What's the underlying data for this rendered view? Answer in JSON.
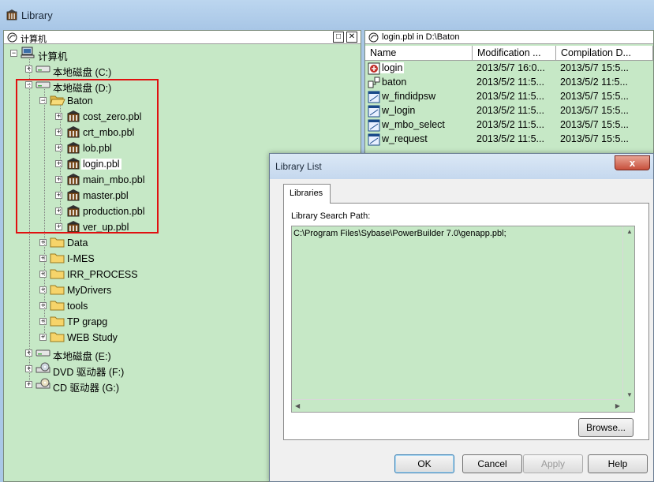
{
  "window": {
    "title": "Library"
  },
  "left_pane": {
    "header": "计算机",
    "buttons": {
      "restore": "□",
      "close": "✕"
    },
    "tree": [
      {
        "label": "计算机",
        "level": 0,
        "expander": "−",
        "icon": "computer-icon"
      },
      {
        "label": "本地磁盘 (C:)",
        "level": 1,
        "expander": "+",
        "icon": "drive-icon"
      },
      {
        "label": "本地磁盘 (D:)",
        "level": 1,
        "expander": "−",
        "icon": "drive-icon"
      },
      {
        "label": "Baton",
        "level": 2,
        "expander": "−",
        "icon": "folder-open-icon"
      },
      {
        "label": "cost_zero.pbl",
        "level": 3,
        "expander": "+",
        "icon": "library-icon"
      },
      {
        "label": "crt_mbo.pbl",
        "level": 3,
        "expander": "+",
        "icon": "library-icon"
      },
      {
        "label": "lob.pbl",
        "level": 3,
        "expander": "+",
        "icon": "library-icon"
      },
      {
        "label": "login.pbl",
        "level": 3,
        "expander": "+",
        "icon": "library-icon",
        "selected": true
      },
      {
        "label": "main_mbo.pbl",
        "level": 3,
        "expander": "+",
        "icon": "library-icon"
      },
      {
        "label": "master.pbl",
        "level": 3,
        "expander": "+",
        "icon": "library-icon"
      },
      {
        "label": "production.pbl",
        "level": 3,
        "expander": "+",
        "icon": "library-icon"
      },
      {
        "label": "ver_up.pbl",
        "level": 3,
        "expander": "+",
        "icon": "library-icon"
      },
      {
        "label": "Data",
        "level": 2,
        "expander": "+",
        "icon": "folder-icon"
      },
      {
        "label": "I-MES",
        "level": 2,
        "expander": "+",
        "icon": "folder-icon"
      },
      {
        "label": "IRR_PROCESS",
        "level": 2,
        "expander": "+",
        "icon": "folder-icon"
      },
      {
        "label": "MyDrivers",
        "level": 2,
        "expander": "+",
        "icon": "folder-icon"
      },
      {
        "label": "tools",
        "level": 2,
        "expander": "+",
        "icon": "folder-icon"
      },
      {
        "label": "TP grapg",
        "level": 2,
        "expander": "+",
        "icon": "folder-icon"
      },
      {
        "label": "WEB Study",
        "level": 2,
        "expander": "+",
        "icon": "folder-icon"
      },
      {
        "label": "本地磁盘 (E:)",
        "level": 1,
        "expander": "+",
        "icon": "drive-icon"
      },
      {
        "label": "DVD 驱动器 (F:)",
        "level": 1,
        "expander": "+",
        "icon": "dvd-icon"
      },
      {
        "label": "CD 驱动器 (G:)",
        "level": 1,
        "expander": "+",
        "icon": "cd-icon"
      }
    ]
  },
  "right_pane": {
    "header": "login.pbl in D:\\Baton",
    "columns": [
      "Name",
      "Modification ...",
      "Compilation D..."
    ],
    "rows": [
      {
        "name": "login",
        "modified": "2013/5/7 16:0...",
        "compiled": "2013/5/7 15:5...",
        "icon": "application-icon",
        "selected": true
      },
      {
        "name": "baton",
        "modified": "2013/5/2 11:5...",
        "compiled": "2013/5/2 11:5...",
        "icon": "structure-icon"
      },
      {
        "name": "w_findidpsw",
        "modified": "2013/5/2 11:5...",
        "compiled": "2013/5/7 15:5...",
        "icon": "window-icon"
      },
      {
        "name": "w_login",
        "modified": "2013/5/2 11:5...",
        "compiled": "2013/5/7 15:5...",
        "icon": "window-icon"
      },
      {
        "name": "w_mbo_select",
        "modified": "2013/5/2 11:5...",
        "compiled": "2013/5/7 15:5...",
        "icon": "window-icon"
      },
      {
        "name": "w_request",
        "modified": "2013/5/2 11:5...",
        "compiled": "2013/5/7 15:5...",
        "icon": "window-icon"
      }
    ]
  },
  "dialog": {
    "title": "Library List",
    "close_glyph": "x",
    "tab": "Libraries",
    "search_path_label": "Library Search Path:",
    "search_path_value": "C:\\Program Files\\Sybase\\PowerBuilder 7.0\\genapp.pbl;",
    "browse_label": "Browse...",
    "buttons": {
      "ok": "OK",
      "cancel": "Cancel",
      "apply": "Apply",
      "help": "Help"
    }
  },
  "colors": {
    "pane_bg": "#c6e8c6",
    "highlight": "#e01010",
    "chrome": "#a9c7e6"
  }
}
